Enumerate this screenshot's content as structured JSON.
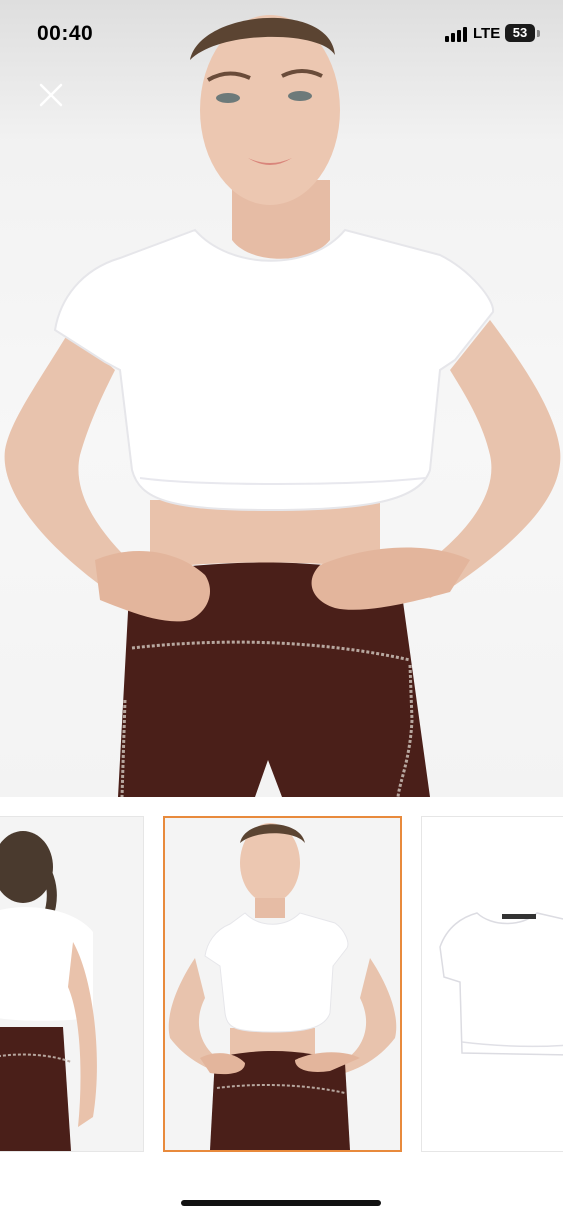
{
  "status_bar": {
    "time": "00:40",
    "network": "LTE",
    "battery": "53"
  },
  "icons": {
    "close": "close-icon",
    "signal": "cellular-signal-icon",
    "battery": "battery-icon"
  },
  "gallery": {
    "selected_index": 1,
    "thumbnails": [
      "back-view",
      "front-view",
      "product-flat-view"
    ]
  },
  "colors": {
    "selected_border": "#e88a3c",
    "top": "#ffffff",
    "leggings": "#4a1f19",
    "stitch": "#b8a8a0"
  }
}
